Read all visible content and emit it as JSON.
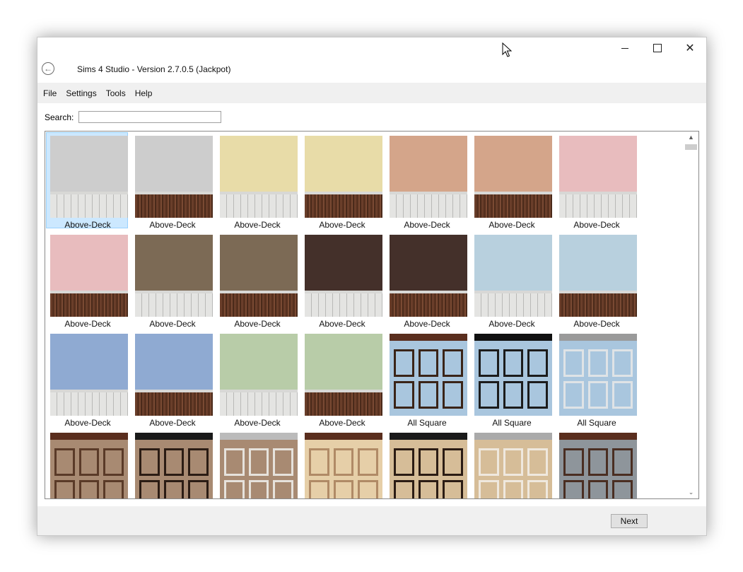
{
  "window": {
    "title": "Sims 4 Studio - Version 2.7.0.5  (Jackpot)",
    "controls": {
      "minimize": "minimize-icon",
      "maximize": "maximize-icon",
      "close": "close-icon"
    }
  },
  "menu": {
    "items": [
      "File",
      "Settings",
      "Tools",
      "Help"
    ]
  },
  "search": {
    "label": "Search:",
    "value": "",
    "placeholder": ""
  },
  "items": [
    {
      "label": "Above-Deck",
      "selected": true,
      "kind": "deck",
      "top": "#cdcdcd",
      "bottom": "white"
    },
    {
      "label": "Above-Deck",
      "kind": "deck",
      "top": "#cdcdcd",
      "bottom": "wood"
    },
    {
      "label": "Above-Deck",
      "kind": "deck",
      "top": "#e8dca8",
      "bottom": "white"
    },
    {
      "label": "Above-Deck",
      "kind": "deck",
      "top": "#e8dca8",
      "bottom": "wood"
    },
    {
      "label": "Above-Deck",
      "kind": "deck",
      "top": "#d4a58a",
      "bottom": "white"
    },
    {
      "label": "Above-Deck",
      "kind": "deck",
      "top": "#d4a58a",
      "bottom": "wood"
    },
    {
      "label": "Above-Deck",
      "kind": "deck",
      "top": "#e8bcbe",
      "bottom": "white"
    },
    {
      "label": "Above-Deck",
      "kind": "deck",
      "top": "#e8bcbe",
      "bottom": "wood"
    },
    {
      "label": "Above-Deck",
      "kind": "deck",
      "top": "#7c6a55",
      "bottom": "white"
    },
    {
      "label": "Above-Deck",
      "kind": "deck",
      "top": "#7c6a55",
      "bottom": "wood"
    },
    {
      "label": "Above-Deck",
      "kind": "deck",
      "top": "#44302a",
      "bottom": "white"
    },
    {
      "label": "Above-Deck",
      "kind": "deck",
      "top": "#44302a",
      "bottom": "wood"
    },
    {
      "label": "Above-Deck",
      "kind": "deck",
      "top": "#b8d0de",
      "bottom": "white"
    },
    {
      "label": "Above-Deck",
      "kind": "deck",
      "top": "#b8d0de",
      "bottom": "wood"
    },
    {
      "label": "Above-Deck",
      "kind": "deck",
      "top": "#8faad2",
      "bottom": "white"
    },
    {
      "label": "Above-Deck",
      "kind": "deck",
      "top": "#8faad2",
      "bottom": "wood"
    },
    {
      "label": "Above-Deck",
      "kind": "deck",
      "top": "#b8cca8",
      "bottom": "white"
    },
    {
      "label": "Above-Deck",
      "kind": "deck",
      "top": "#b8cca8",
      "bottom": "wood"
    },
    {
      "label": "All Square",
      "kind": "panel",
      "fill": "#a9c6de",
      "frame": "#3a2418",
      "topc": "#5a2e1e"
    },
    {
      "label": "All Square",
      "kind": "panel",
      "fill": "#a9c6de",
      "frame": "#1c1c1c",
      "topc": "#111111"
    },
    {
      "label": "All Square",
      "kind": "panel",
      "fill": "#a9c6de",
      "frame": "#dfe3e6",
      "topc": "#9a9a9a"
    },
    {
      "label": "",
      "kind": "panel",
      "fill": "#a88a72",
      "frame": "#5a3a28",
      "topc": "#5a2e1e"
    },
    {
      "label": "",
      "kind": "panel",
      "fill": "#a88a72",
      "frame": "#2b1c14",
      "topc": "#1a1a1a"
    },
    {
      "label": "",
      "kind": "panel",
      "fill": "#a88a72",
      "frame": "#e6e2dc",
      "topc": "#bbbbbb"
    },
    {
      "label": "",
      "kind": "panel",
      "fill": "#e6cfa8",
      "frame": "#b08a66",
      "topc": "#5a2e1e"
    },
    {
      "label": "",
      "kind": "panel",
      "fill": "#d6bd98",
      "frame": "#2b1c14",
      "topc": "#1a1a1a"
    },
    {
      "label": "",
      "kind": "panel",
      "fill": "#d6bd98",
      "frame": "#efe8de",
      "topc": "#aaaaaa"
    },
    {
      "label": "",
      "kind": "panel",
      "fill": "#8e959b",
      "frame": "#4a2e22",
      "topc": "#5a2e1e"
    }
  ],
  "footer": {
    "next_label": "Next"
  },
  "icons": {
    "back": "back-arrow-icon",
    "scroll_up": "chevron-up-icon",
    "scroll_down": "chevron-down-icon"
  }
}
